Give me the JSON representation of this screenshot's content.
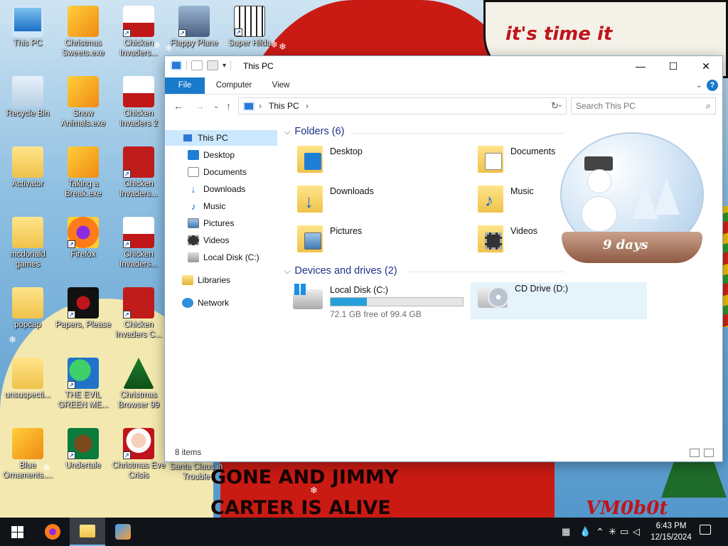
{
  "wallpaper": {
    "banner_text": "it's time it",
    "bottom_text_1": "GONE AND JIMMY",
    "bottom_text_2": "CARTER IS ALIVE",
    "signature": "VM0b0t",
    "countdown": "9 days"
  },
  "desktop_icons": [
    {
      "label": "This PC",
      "icon": "pc-icon"
    },
    {
      "label": "Christmas Sweets.exe",
      "icon": "exe-icon"
    },
    {
      "label": "Chicken Invaders...",
      "icon": "chicken-game-icon"
    },
    {
      "label": "Flappy Plane",
      "icon": "image-icon"
    },
    {
      "label": "Super Hilda",
      "icon": "pixel-art-icon"
    },
    {
      "label": "Recycle Bin",
      "icon": "recycle-bin-icon"
    },
    {
      "label": "Snow Animals.exe",
      "icon": "exe-icon"
    },
    {
      "label": "Chicken Invaders 2",
      "icon": "chicken-game-icon"
    },
    {
      "label": "Activator",
      "icon": "folder-icon"
    },
    {
      "label": "Taking a Break.exe",
      "icon": "exe-icon"
    },
    {
      "label": "Chicken Invaders...",
      "icon": "chicken-game-icon"
    },
    {
      "label": "mcdonald games",
      "icon": "folder-icon"
    },
    {
      "label": "Firefox",
      "icon": "firefox-icon"
    },
    {
      "label": "Chicken Invaders...",
      "icon": "chicken-game-icon"
    },
    {
      "label": "popcap",
      "icon": "folder-icon"
    },
    {
      "label": "Papers, Please",
      "icon": "papers-please-icon"
    },
    {
      "label": "Chicken Invaders C...",
      "icon": "chicken-game-icon"
    },
    {
      "label": "unsuspecti...",
      "icon": "folder-icon"
    },
    {
      "label": "THE EVIL GREEN ME...",
      "icon": "msn-icon"
    },
    {
      "label": "Christmas Browser 99",
      "icon": "christmas-tree-icon"
    },
    {
      "label": "Blue Ornaments....",
      "icon": "exe-icon"
    },
    {
      "label": "Undertale",
      "icon": "undertale-icon"
    },
    {
      "label": "Christmas Eve Crisis",
      "icon": "santa-icon"
    },
    {
      "label": "Santa Claus in Trouble",
      "icon": "santa-icon"
    }
  ],
  "window": {
    "title": "This PC",
    "controls": {
      "minimize": "—",
      "maximize": "☐",
      "close": "✕"
    },
    "ribbon_tabs": [
      "File",
      "Computer",
      "View"
    ],
    "address": {
      "crumb": "This PC",
      "separator": "›"
    },
    "search_placeholder": "Search This PC",
    "nav_pane": [
      {
        "label": "This PC",
        "icon": "pc-icon",
        "selected": true
      },
      {
        "label": "Desktop",
        "icon": "desktop-icon"
      },
      {
        "label": "Documents",
        "icon": "documents-icon"
      },
      {
        "label": "Downloads",
        "icon": "downloads-icon"
      },
      {
        "label": "Music",
        "icon": "music-icon"
      },
      {
        "label": "Pictures",
        "icon": "pictures-icon"
      },
      {
        "label": "Videos",
        "icon": "videos-icon"
      },
      {
        "label": "Local Disk (C:)",
        "icon": "disk-icon"
      },
      {
        "label": "Libraries",
        "icon": "libraries-icon"
      },
      {
        "label": "Network",
        "icon": "network-icon"
      }
    ],
    "folders_header": "Folders (6)",
    "folders": [
      {
        "name": "Desktop",
        "icon": "desktop-folder-icon"
      },
      {
        "name": "Documents",
        "icon": "documents-folder-icon"
      },
      {
        "name": "Downloads",
        "icon": "downloads-folder-icon"
      },
      {
        "name": "Music",
        "icon": "music-folder-icon"
      },
      {
        "name": "Pictures",
        "icon": "pictures-folder-icon"
      },
      {
        "name": "Videos",
        "icon": "videos-folder-icon"
      }
    ],
    "drives_header": "Devices and drives (2)",
    "drives": [
      {
        "name": "Local Disk (C:)",
        "free_text": "72.1 GB free of 99.4 GB",
        "used_fraction": 0.275
      },
      {
        "name": "CD Drive (D:)"
      }
    ],
    "status_text": "8 items"
  },
  "taskbar": {
    "apps": [
      "Start",
      "Firefox",
      "File Explorer",
      "Windows Live Messenger"
    ],
    "clock_time": "6:43 PM",
    "clock_date": "12/15/2024"
  },
  "colors": {
    "accent": "#1979ca",
    "selected": "#cce8ff",
    "header_text": "#1e3287",
    "disk_fill": "#26a0da"
  }
}
